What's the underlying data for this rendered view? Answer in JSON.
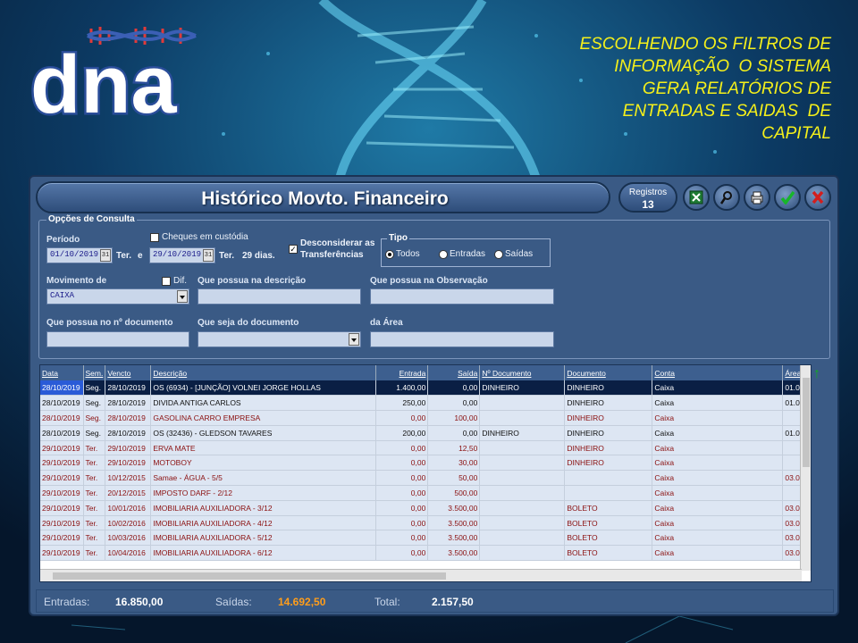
{
  "promo": {
    "lines": [
      "ESCOLHENDO OS FILTROS DE",
      "INFORMAÇÃO  O SISTEMA",
      "GERA RELATÓRIOS DE",
      "ENTRADAS E SAIDAS  DE",
      "CAPITAL"
    ]
  },
  "logo": {
    "text": "dna"
  },
  "window": {
    "title": "Histórico Movto. Financeiro",
    "registros_label": "Registros",
    "registros_count": "13"
  },
  "options": {
    "legend": "Opções de Consulta",
    "periodo_label": "Período",
    "date_from": "01/10/2019",
    "date_from_day": "Ter.",
    "between": "e",
    "date_to": "29/10/2019",
    "date_to_day": "Ter.",
    "days": "29 dias.",
    "cheques_label": "Cheques em custódia",
    "desconsiderar_label_1": "Desconsiderar as",
    "desconsiderar_label_2": "Transferências",
    "tipo_label": "Tipo",
    "tipo_todos": "Todos",
    "tipo_entradas": "Entradas",
    "tipo_saidas": "Saídas",
    "movimento_label": "Movimento de",
    "movimento_value": "CAIXA",
    "dif_label": "Dif.",
    "descricao_label": "Que possua na descrição",
    "observacao_label": "Que possua na Observação",
    "documento_num_label": "Que possua no nº documento",
    "documento_tipo_label": "Que seja do documento",
    "area_label": "da Área"
  },
  "table": {
    "columns": [
      "Data",
      "Sem.",
      "Vencto",
      "Descrição",
      "Entrada",
      "Saída",
      "Nº Documento",
      "Documento",
      "Conta",
      "Área"
    ],
    "rows": [
      {
        "data": "28/10/2019",
        "sem": "Seg.",
        "vencto": "28/10/2019",
        "desc": "OS (6934) - [JUNÇÃO] VOLNEI JORGE HOLLAS",
        "entrada": "1.400,00",
        "saida": "0,00",
        "ndoc": "DINHEIRO",
        "doc": "DINHEIRO",
        "conta": "Caixa",
        "area": "01.0",
        "style": "sel"
      },
      {
        "data": "28/10/2019",
        "sem": "Seg.",
        "vencto": "28/10/2019",
        "desc": "DIVIDA ANTIGA CARLOS",
        "entrada": "250,00",
        "saida": "0,00",
        "ndoc": "",
        "doc": "DINHEIRO",
        "conta": "Caixa",
        "area": "01.0",
        "style": "normal"
      },
      {
        "data": "28/10/2019",
        "sem": "Seg.",
        "vencto": "28/10/2019",
        "desc": "GASOLINA CARRO EMPRESA",
        "entrada": "0,00",
        "saida": "100,00",
        "ndoc": "",
        "doc": "DINHEIRO",
        "conta": "Caixa",
        "area": "",
        "style": "red"
      },
      {
        "data": "28/10/2019",
        "sem": "Seg.",
        "vencto": "28/10/2019",
        "desc": "OS (32436) - GLEDSON TAVARES",
        "entrada": "200,00",
        "saida": "0,00",
        "ndoc": "DINHEIRO",
        "doc": "DINHEIRO",
        "conta": "Caixa",
        "area": "01.0",
        "style": "normal"
      },
      {
        "data": "29/10/2019",
        "sem": "Ter.",
        "vencto": "29/10/2019",
        "desc": "ERVA MATE",
        "entrada": "0,00",
        "saida": "12,50",
        "ndoc": "",
        "doc": "DINHEIRO",
        "conta": "Caixa",
        "area": "",
        "style": "red"
      },
      {
        "data": "29/10/2019",
        "sem": "Ter.",
        "vencto": "29/10/2019",
        "desc": "MOTOBOY",
        "entrada": "0,00",
        "saida": "30,00",
        "ndoc": "",
        "doc": "DINHEIRO",
        "conta": "Caixa",
        "area": "",
        "style": "red"
      },
      {
        "data": "29/10/2019",
        "sem": "Ter.",
        "vencto": "10/12/2015",
        "desc": "Samae - ÁGUA - 5/5",
        "entrada": "0,00",
        "saida": "50,00",
        "ndoc": "",
        "doc": "",
        "conta": "Caixa",
        "area": "03.0",
        "style": "red"
      },
      {
        "data": "29/10/2019",
        "sem": "Ter.",
        "vencto": "20/12/2015",
        "desc": "IMPOSTO DARF - 2/12",
        "entrada": "0,00",
        "saida": "500,00",
        "ndoc": "",
        "doc": "",
        "conta": "Caixa",
        "area": "",
        "style": "red"
      },
      {
        "data": "29/10/2019",
        "sem": "Ter.",
        "vencto": "10/01/2016",
        "desc": "IMOBILIARIA AUXILIADORA - 3/12",
        "entrada": "0,00",
        "saida": "3.500,00",
        "ndoc": "",
        "doc": "BOLETO",
        "conta": "Caixa",
        "area": "03.0",
        "style": "red"
      },
      {
        "data": "29/10/2019",
        "sem": "Ter.",
        "vencto": "10/02/2016",
        "desc": "IMOBILIARIA AUXILIADORA - 4/12",
        "entrada": "0,00",
        "saida": "3.500,00",
        "ndoc": "",
        "doc": "BOLETO",
        "conta": "Caixa",
        "area": "03.0",
        "style": "red"
      },
      {
        "data": "29/10/2019",
        "sem": "Ter.",
        "vencto": "10/03/2016",
        "desc": "IMOBILIARIA AUXILIADORA - 5/12",
        "entrada": "0,00",
        "saida": "3.500,00",
        "ndoc": "",
        "doc": "BOLETO",
        "conta": "Caixa",
        "area": "03.0",
        "style": "red"
      },
      {
        "data": "29/10/2019",
        "sem": "Ter.",
        "vencto": "10/04/2016",
        "desc": "IMOBILIARIA AUXILIADORA - 6/12",
        "entrada": "0,00",
        "saida": "3.500,00",
        "ndoc": "",
        "doc": "BOLETO",
        "conta": "Caixa",
        "area": "03.0",
        "style": "red"
      }
    ]
  },
  "footer": {
    "entradas_label": "Entradas:",
    "entradas_value": "16.850,00",
    "saidas_label": "Saídas:",
    "saidas_value": "14.692,50",
    "total_label": "Total:",
    "total_value": "2.157,50",
    "saidas_color": "#ff9d1a"
  },
  "icons": {
    "toolbar": [
      "excel-icon",
      "search-icon",
      "print-icon",
      "confirm-check-icon",
      "close-x-icon"
    ]
  }
}
